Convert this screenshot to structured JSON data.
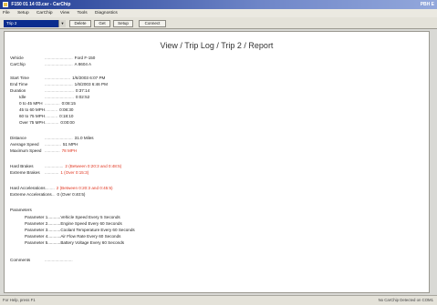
{
  "window": {
    "title": "F150 01 14 03.car - CarChip",
    "title_right": "PBH E"
  },
  "menu": [
    "File",
    "Setup",
    "CarChip",
    "View",
    "Tools",
    "Diagnostics"
  ],
  "toolbar": {
    "trip_select": "Trip 2",
    "buttons": [
      "Delete",
      "Get",
      "Setup",
      "Connect"
    ]
  },
  "report": {
    "title": "View / Trip Log / Trip 2 / Report",
    "vehicle": {
      "label": "Vehicle",
      "dots": "........................",
      "value": "Ford F-150"
    },
    "carchip": {
      "label": "CarChip",
      "dots": "........................",
      "value": "A 8604 A"
    },
    "start_time": {
      "label": "Start Time",
      "dots": "......................",
      "value": "1/6/2003 6:07 PM"
    },
    "end_time": {
      "label": "End Time",
      "dots": "........................",
      "value": "1/6/2003 6:46 PM"
    },
    "duration": {
      "label": "Duration",
      "dots": ".........................",
      "value": "0:37:14"
    },
    "durations": [
      {
        "label": "Idle",
        "dots": ".........................",
        "value": "0:02:52"
      },
      {
        "label": "0 to 45 MPH",
        "dots": ".............",
        "value": "0:08:15"
      },
      {
        "label": "45 to 60 MPH",
        "dots": "...........",
        "value": "0:08:30"
      },
      {
        "label": "60 to 75 MPH",
        "dots": "...........",
        "value": "0:18:10"
      },
      {
        "label": "Over 75 MPH",
        "dots": "............",
        "value": "0:00:00"
      }
    ],
    "distance": {
      "label": "Distance",
      "dots": "........................",
      "value": "31.0 Miles"
    },
    "avg_speed": {
      "label": "Average Speed",
      "dots": "..............",
      "value": "51 MPH"
    },
    "max_speed": {
      "label": "Maximum Speed",
      "dots": ".............",
      "value": "78 MPH"
    },
    "hard_brakes": {
      "label": "Hard Brakes",
      "dots": "................",
      "value": "2 (Between 0:20:3 and 0:48:5)"
    },
    "extreme_brakes": {
      "label": "Extreme Brakes",
      "dots": "............",
      "value": "1 (Over 0:15:3)"
    },
    "hard_accel": {
      "label": "Hard Accelerations",
      "dots": "........",
      "value": "2 (Between 0:20:3 and 0:45:5)"
    },
    "extreme_accel": {
      "label": "Extreme Accelerations",
      "dots": "...",
      "value": "0 (Over 0:40:5)"
    },
    "parameters_title": "Parameters",
    "parameters": [
      {
        "label": "Parameter 1",
        "dots": "...........",
        "value": "Vehicle Speed Every 5 Seconds"
      },
      {
        "label": "Parameter 2",
        "dots": "...........",
        "value": "Engine Speed Every 60 Seconds"
      },
      {
        "label": "Parameter 3",
        "dots": "...........",
        "value": "Coolant Temperature Every 60 Seconds"
      },
      {
        "label": "Parameter 4",
        "dots": "...........",
        "value": "Air Flow Rate Every 60 Seconds"
      },
      {
        "label": "Parameter 5",
        "dots": "...........",
        "value": "Battery Voltage Every 60 Seconds"
      }
    ],
    "comments": {
      "label": "Comments",
      "dots": "........................"
    }
  },
  "statusbar": {
    "left": "For Help, press F1",
    "right": "No CarChip Detected on COM1"
  },
  "colors": {
    "title_bar": "#1e3a92",
    "highlight_red": "#e0341e",
    "trip_select_bg": "#0b2c8e"
  }
}
